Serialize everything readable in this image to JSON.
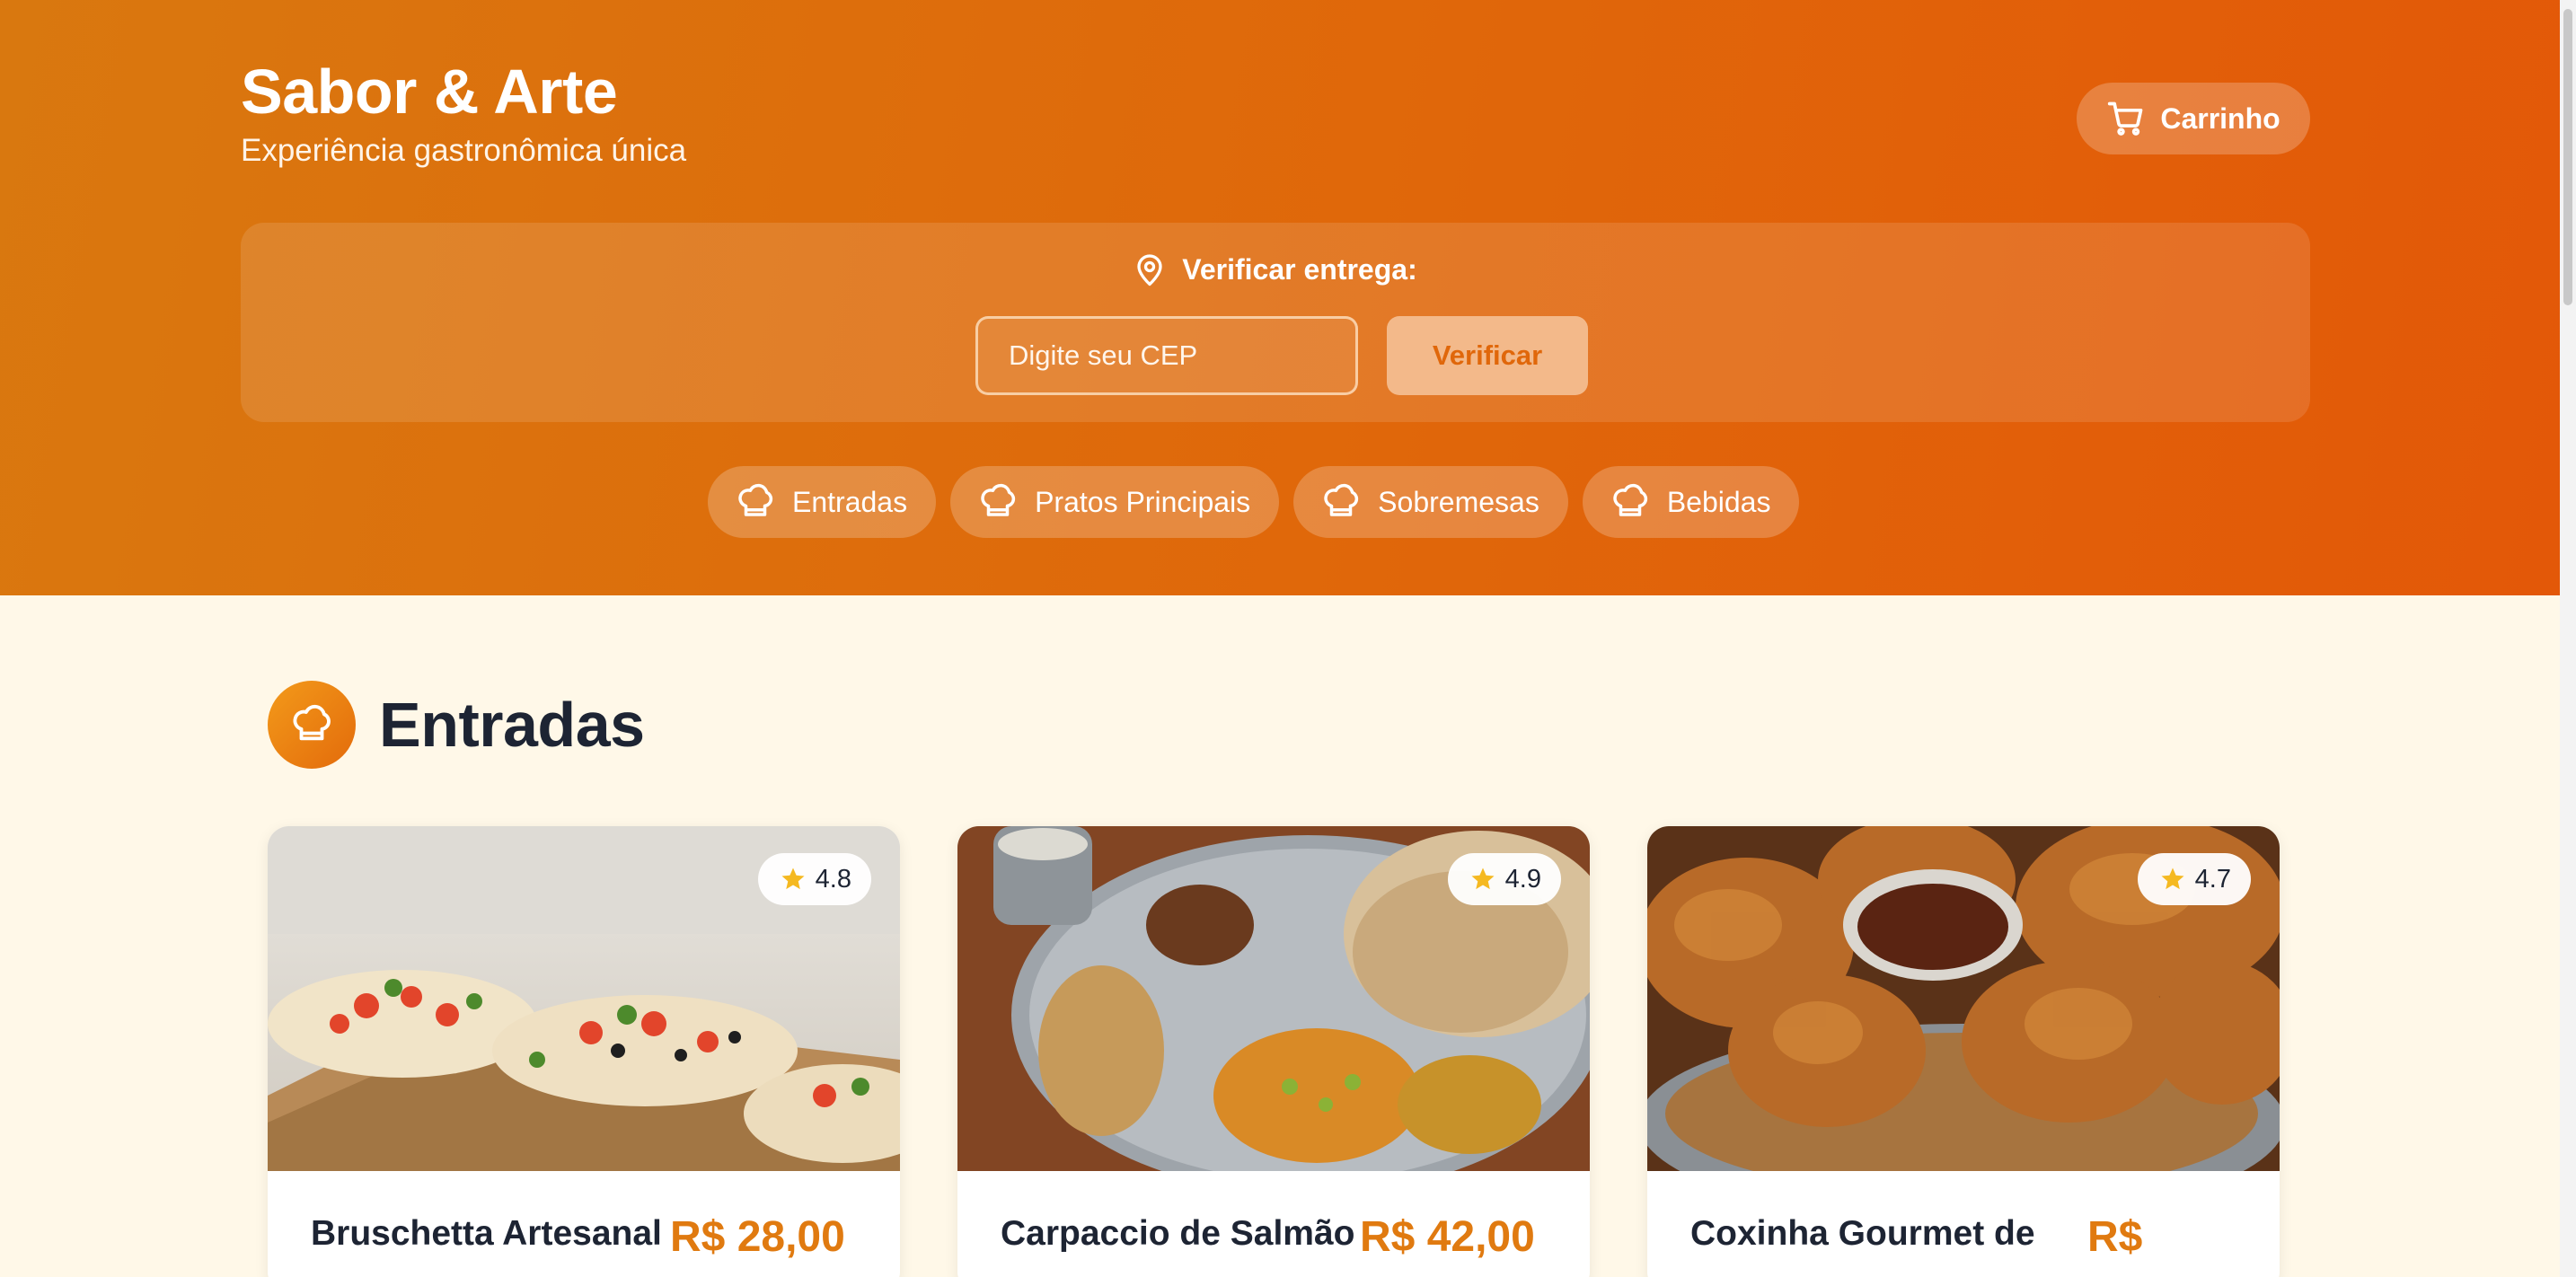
{
  "header": {
    "brand_title": "Sabor & Arte",
    "brand_subtitle": "Experiência gastronômica única",
    "cart_label": "Carrinho",
    "cart_icon": "cart-icon"
  },
  "delivery": {
    "label": "Verificar entrega:",
    "icon": "map-pin-icon",
    "cep_placeholder": "Digite seu CEP",
    "cep_value": "",
    "verify_label": "Verificar"
  },
  "categories": [
    {
      "label": "Entradas",
      "icon": "chef-hat-icon"
    },
    {
      "label": "Pratos Principais",
      "icon": "chef-hat-icon"
    },
    {
      "label": "Sobremesas",
      "icon": "chef-hat-icon"
    },
    {
      "label": "Bebidas",
      "icon": "chef-hat-icon"
    }
  ],
  "section": {
    "title": "Entradas",
    "icon": "chef-hat-icon"
  },
  "dishes": [
    {
      "name": "Bruschetta Artesanal",
      "price": "R$ 28,00",
      "rating": "4.8",
      "image": "bruschetta-photo"
    },
    {
      "name": "Carpaccio de Salmão",
      "price": "R$ 42,00",
      "rating": "4.9",
      "image": "thali-platter-photo"
    },
    {
      "name": "Coxinha Gourmet de",
      "price": "R$",
      "rating": "4.7",
      "image": "fried-chicken-photo"
    }
  ],
  "colors": {
    "header_start": "#d9780f",
    "header_end": "#e35808",
    "accent": "#e07a10",
    "page_bg": "#fff8e8",
    "star": "#f5b921"
  }
}
